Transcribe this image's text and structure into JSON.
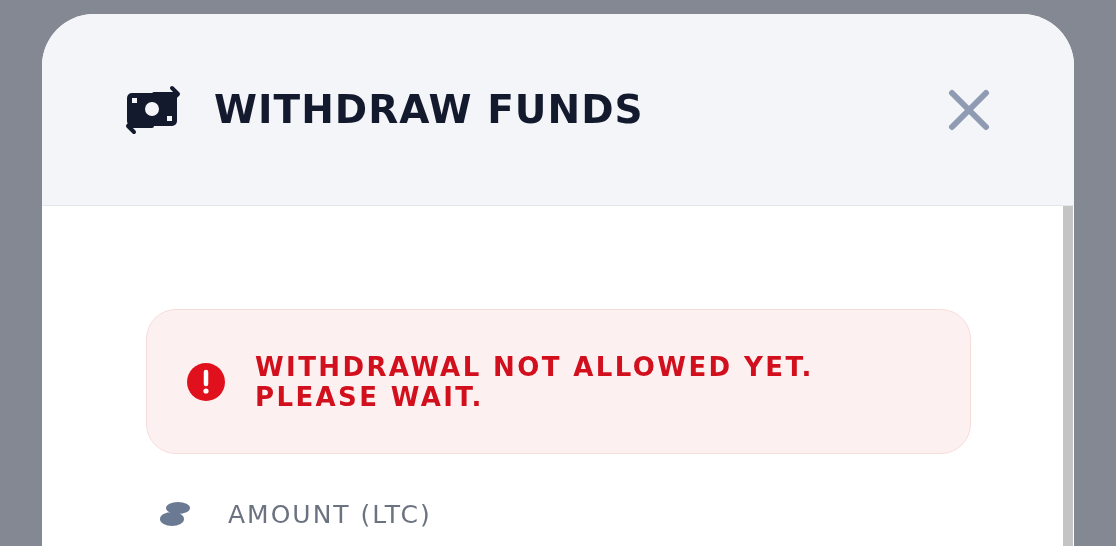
{
  "dialog": {
    "title": "WITHDRAW FUNDS"
  },
  "alert": {
    "kind": "error",
    "message": "WITHDRAWAL NOT ALLOWED YET.\nPLEASE WAIT."
  },
  "amount_field": {
    "label": "AMOUNT (LTC)"
  }
}
